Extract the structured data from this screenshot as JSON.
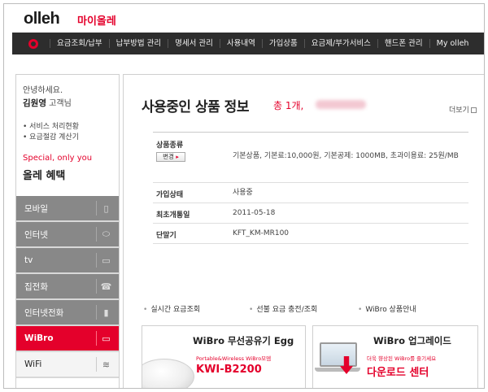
{
  "header": {
    "logo": "olleh",
    "subtitle": "마이올레"
  },
  "topnav": {
    "items": [
      "요금조회/납부",
      "납부방법 관리",
      "명세서 관리",
      "사용내역",
      "가입상품",
      "요금제/부가서비스",
      "핸드폰 관리",
      "My olleh"
    ]
  },
  "sidebar": {
    "greeting": "안녕하세요.",
    "user_name": "김원영",
    "user_suffix": "고객님",
    "links": [
      "• 서비스 처리현황",
      "• 요금절감 계산기"
    ],
    "special": "Special, only you",
    "benefit": "올레 혜택",
    "menu": [
      "모바일",
      "인터넷",
      "tv",
      "집전화",
      "인터넷전화",
      "WiBro",
      "WiFi"
    ],
    "menu_icons": [
      "phone-icon",
      "mouse-icon",
      "tv-icon",
      "telephone-icon",
      "handset-icon",
      "wibro-icon",
      "wifi-icon"
    ]
  },
  "main": {
    "title": "사용중인 상품 정보",
    "count": "총 1개,",
    "more": "더보기",
    "rows": [
      {
        "key": "상품종류",
        "button": "변경",
        "value": "기본상품, 기본료:10,000원, 기본공제: 1000MB, 초과이용료: 25원/MB"
      },
      {
        "key": "가입상태",
        "value": "사용중"
      },
      {
        "key": "최초개통일",
        "value": "2011-05-18"
      },
      {
        "key": "단말기",
        "value": "KFT_KM-MR100"
      }
    ],
    "quick_links": [
      "실시간 요금조회",
      "선불 요금 충전/조회",
      "WiBro 상품안내"
    ]
  },
  "banners": [
    {
      "title": "WiBro 무선공유기 Egg",
      "sub": "Portable&Wireless WiBro모뎀",
      "big": "KWI-B2200"
    },
    {
      "title": "WiBro 업그레이드",
      "sub": "더욱 향상된 WiBro를 즐기세요",
      "big": "다운로드 센터"
    }
  ],
  "colors": {
    "accent": "#e4002b",
    "nav_bg": "#2d2d2d",
    "menu_bg": "#888888"
  }
}
